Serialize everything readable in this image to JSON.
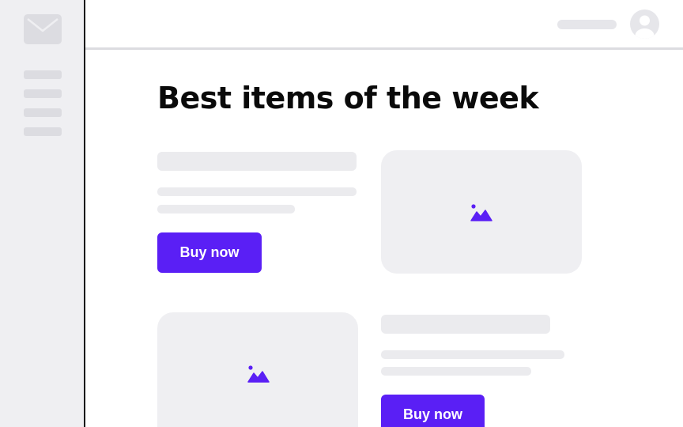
{
  "main": {
    "title": "Best items of the week",
    "products": [
      {
        "buy_label": "Buy now"
      },
      {
        "buy_label": "Buy now"
      }
    ]
  },
  "colors": {
    "accent": "#5a1ff5",
    "placeholder": "#efeff2",
    "skeleton": "#ebebee"
  },
  "icons": {
    "sidebar": "mail-icon",
    "header": "user-avatar-icon",
    "product_image": "image-icon"
  }
}
